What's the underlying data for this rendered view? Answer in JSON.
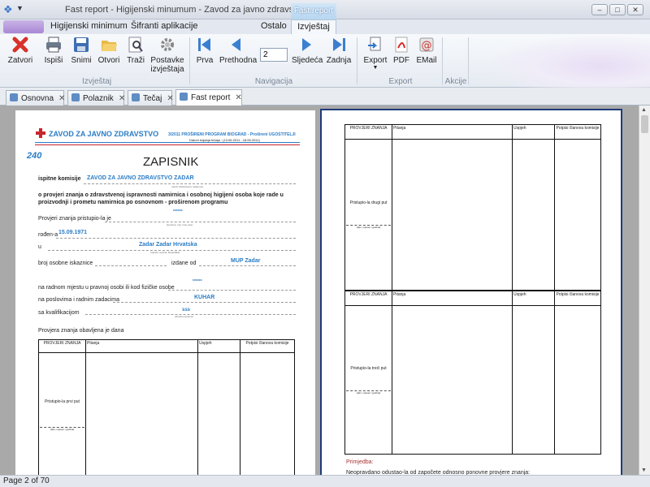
{
  "window": {
    "title": "Fast report - Higijenski minumum - Zavod za javno zdravstvo Zadar",
    "context_tab": "Fast report",
    "controls": {
      "minimize": "–",
      "maximize": "□",
      "close": "✕"
    }
  },
  "menu": {
    "tabs": [
      "Higijenski minimum",
      "Šifranti aplikacije",
      "Ostalo",
      "Izvještaj"
    ]
  },
  "ribbon": {
    "group1": {
      "name": "Izvještaj",
      "buttons": [
        "Zatvori",
        "Ispiši",
        "Snimi",
        "Otvori",
        "Traži",
        "Postavke izvještaja"
      ]
    },
    "group2": {
      "name": "Navigacija",
      "buttons": [
        "Prva",
        "Prethodna",
        "Sljedeća",
        "Zadnja"
      ],
      "page_value": "2"
    },
    "group3": {
      "name": "Export",
      "buttons": [
        "Export",
        "PDF",
        "EMail"
      ]
    },
    "group4": {
      "name": "Akcije"
    }
  },
  "doc_tabs": [
    "Osnovna",
    "Polaznik",
    "Tečaj",
    "Fast report"
  ],
  "status": "Page 2 of 70",
  "report": {
    "org": "ZAVOD ZA JAVNO ZDRAVSTVO",
    "header_right": "3/2011 PROŠIRENI PROGRAM BIOGRAD - Prošireni UGOSTITELJI",
    "dates": "Datum trajanja tečaja : (13.06.2011 - 18.06.2011)",
    "number": "240",
    "title": "ZAPISNIK",
    "commission_label": "ispitne komisije",
    "commission_value": "ZAVOD ZA JAVNO ZDRAVSTVO ZADAR",
    "commission_hint": "(naziv zdravstvene ustanove)",
    "para": "o provjeri znanja o zdravstvenoj ispravnosti namirnica i osobnoj higijeni osoba koje rade u proizvodnji i prometu namirnica po osnovnom - proširenom programu",
    "rows": [
      {
        "label": "Provjeri znanja pristupio-la je",
        "value": "******",
        "hint": "(ime/ime, ime i ime oca)"
      },
      {
        "label": "rođen-a",
        "value": "15.09.1971",
        "hint": ""
      },
      {
        "label": "u",
        "value": "Zadar Zadar Hrvatska",
        "hint": "(mjesto, općina, Republika)"
      },
      {
        "label": "broj osobne iskaznice",
        "label2": "izdane od",
        "value": "MUP Zadar",
        "hint": ""
      },
      {
        "label": "na radnom mjestu u pravnoj osobi ili kod fizičke osobe",
        "value": "******",
        "hint": ""
      },
      {
        "label": "na poslovima i radnim zadacima",
        "value": "KUHAR",
        "hint": ""
      },
      {
        "label": "sa kvalifikacijom",
        "value": "sss",
        "hint": "(stručna sprema)"
      }
    ],
    "table_caption": "Provjera znanja obavljena je dana",
    "col_headers": [
      "PROVJERI ZNANJA",
      "Pitanja",
      "Uspjeh",
      "Potpisi članova komisije"
    ],
    "attempt1": "Pristupio-la prvi put",
    "attempt2": "Pristupio-la drugi put",
    "attempt3": "Pristupio-la treći put",
    "sign_hint": "(dan, mjesec i godina)",
    "remark_label": "Primjedba:",
    "remark_text": "Neopravdano odustao-la od započete odnosno ponovne provjere znanja:"
  },
  "colors": {
    "accent": "#2a7cc6",
    "remark": "#a83232",
    "frame": "#1f3a7a"
  }
}
